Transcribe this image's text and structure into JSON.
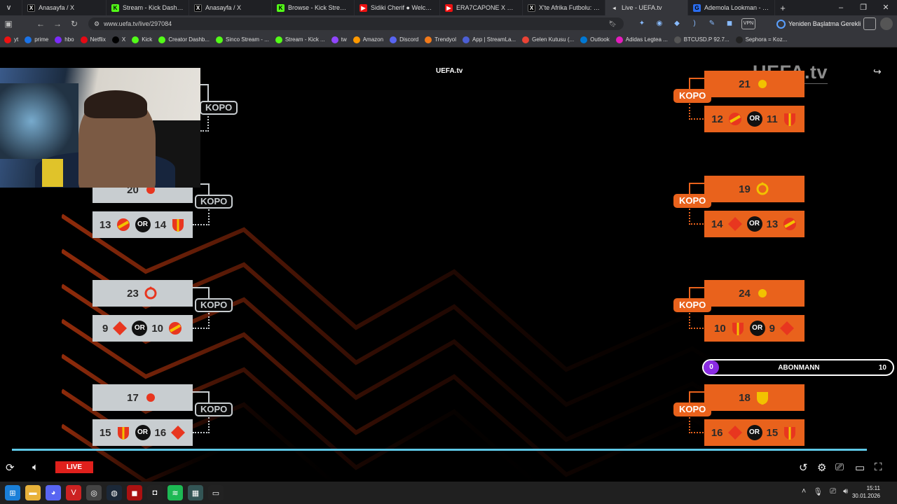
{
  "tabs": [
    {
      "label": "Anasayfa / X",
      "icon": "x"
    },
    {
      "label": "Stream - Kick Dashboard",
      "icon": "k"
    },
    {
      "label": "Anasayfa / X",
      "icon": "x"
    },
    {
      "label": "Browse - Kick Streaming",
      "icon": "k"
    },
    {
      "label": "Sidiki Cherif ● Welcome to",
      "icon": "yt"
    },
    {
      "label": "ERA7CAPONE X MURDA B",
      "icon": "yt"
    },
    {
      "label": "X'te Afrika Futbolu: \" Fe",
      "icon": "x"
    },
    {
      "label": "Live - UEFA.tv",
      "icon": "u"
    },
    {
      "label": "Ademola Lookman - Oyunc",
      "icon": "g"
    }
  ],
  "address": {
    "url": "www.uefa.tv/live/297084",
    "update_label": "Yeniden Başlatma Gerekli",
    "vpn": "VPN"
  },
  "bookmarks": [
    "yt",
    "prime",
    "hbo",
    "Netflix",
    "X",
    "Kick",
    "Creator Dashb...",
    "Sinco Stream - ...",
    "Stream - Kick ...",
    "tw",
    "Amazon",
    "Discord",
    "Trendyol",
    "App | StreamLa...",
    "Gelen Kutusu (...",
    "Outlook",
    "Adidas Legtea ...",
    "BTCUSD.P 92.7...",
    "Sephora = Koz..."
  ],
  "video": {
    "logo_small": "UEFA.tv",
    "logo_big": "UEFA.tv",
    "kopo": "KOPO",
    "or": "OR",
    "left": [
      {
        "top": "20",
        "a": "13",
        "b": "14"
      },
      {
        "top": "23",
        "a": "9",
        "b": "10"
      },
      {
        "top": "17",
        "a": "15",
        "b": "16"
      }
    ],
    "right": [
      {
        "top": "21",
        "a": "12",
        "b": "11"
      },
      {
        "top": "19",
        "a": "14",
        "b": "13"
      },
      {
        "top": "24",
        "a": "10",
        "b": "9"
      },
      {
        "top": "18",
        "a": "16",
        "b": "15"
      }
    ],
    "sub_goal": {
      "current": "0",
      "label": "ABONMANN",
      "target": "10"
    },
    "live_label": "LIVE",
    "progress": 0.98
  },
  "taskbar": {
    "time": "15:11",
    "date": "30.01.2026"
  },
  "colors": {
    "orange": "#e9621c",
    "gray": "#c8cdd0",
    "live": "#e0201c",
    "progress": "#5ec8e6"
  }
}
